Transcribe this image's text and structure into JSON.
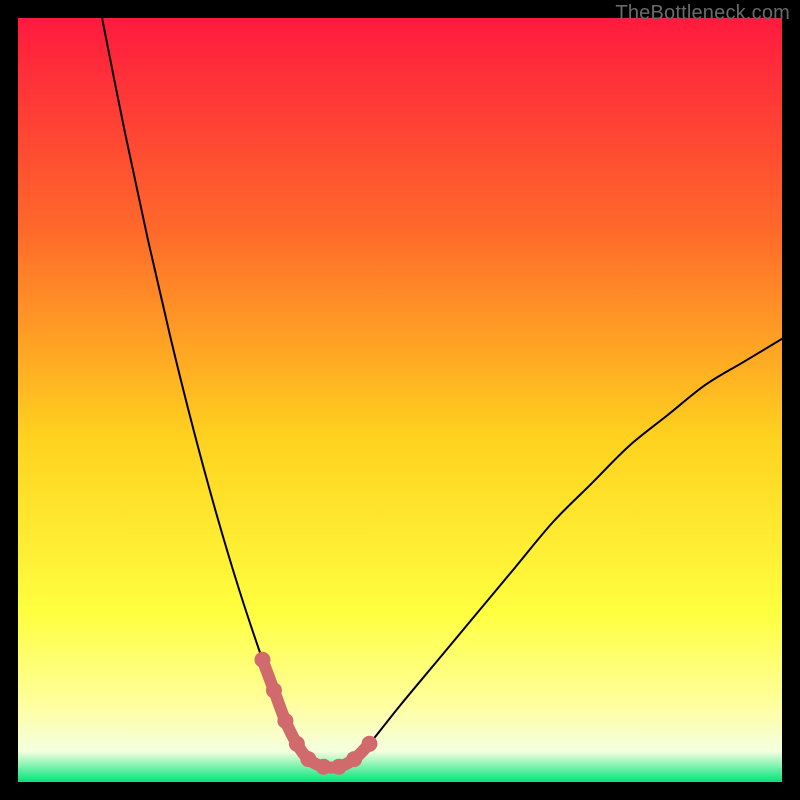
{
  "watermark": "TheBottleneck.com",
  "colors": {
    "frame": "#000000",
    "curve": "#000000",
    "marker_stroke": "#d16a6c",
    "marker_fill": "#d16a6c",
    "gradient_top": "#ff1a3f",
    "gradient_mid1": "#ff6a2a",
    "gradient_mid2": "#ffd21f",
    "gradient_mid3": "#ffff40",
    "gradient_mid35": "#ffffa0",
    "gradient_mid4": "#f4ffe0",
    "gradient_bottom": "#00e57a"
  },
  "chart_data": {
    "type": "line",
    "title": "",
    "xlabel": "",
    "ylabel": "",
    "xlim": [
      0,
      100
    ],
    "ylim": [
      0,
      100
    ],
    "legend": false,
    "grid": false,
    "series": [
      {
        "name": "curve",
        "x": [
          11,
          14,
          17,
          20,
          23,
          26,
          29,
          32,
          33.5,
          35,
          36.5,
          38,
          40,
          42,
          44,
          46,
          50,
          55,
          60,
          65,
          70,
          75,
          80,
          85,
          90,
          95,
          100
        ],
        "y": [
          100,
          85,
          71,
          58,
          46,
          35,
          25,
          16,
          12,
          8,
          5,
          3,
          2,
          2,
          3,
          5,
          10,
          16,
          22,
          28,
          34,
          39,
          44,
          48,
          52,
          55,
          58
        ]
      }
    ],
    "markers": {
      "name": "bottom-points",
      "x": [
        32,
        33.5,
        35,
        36.5,
        38,
        40,
        42,
        44,
        46
      ],
      "y": [
        16,
        12,
        8,
        5,
        3,
        2,
        2,
        3,
        5
      ],
      "connected": true
    }
  }
}
